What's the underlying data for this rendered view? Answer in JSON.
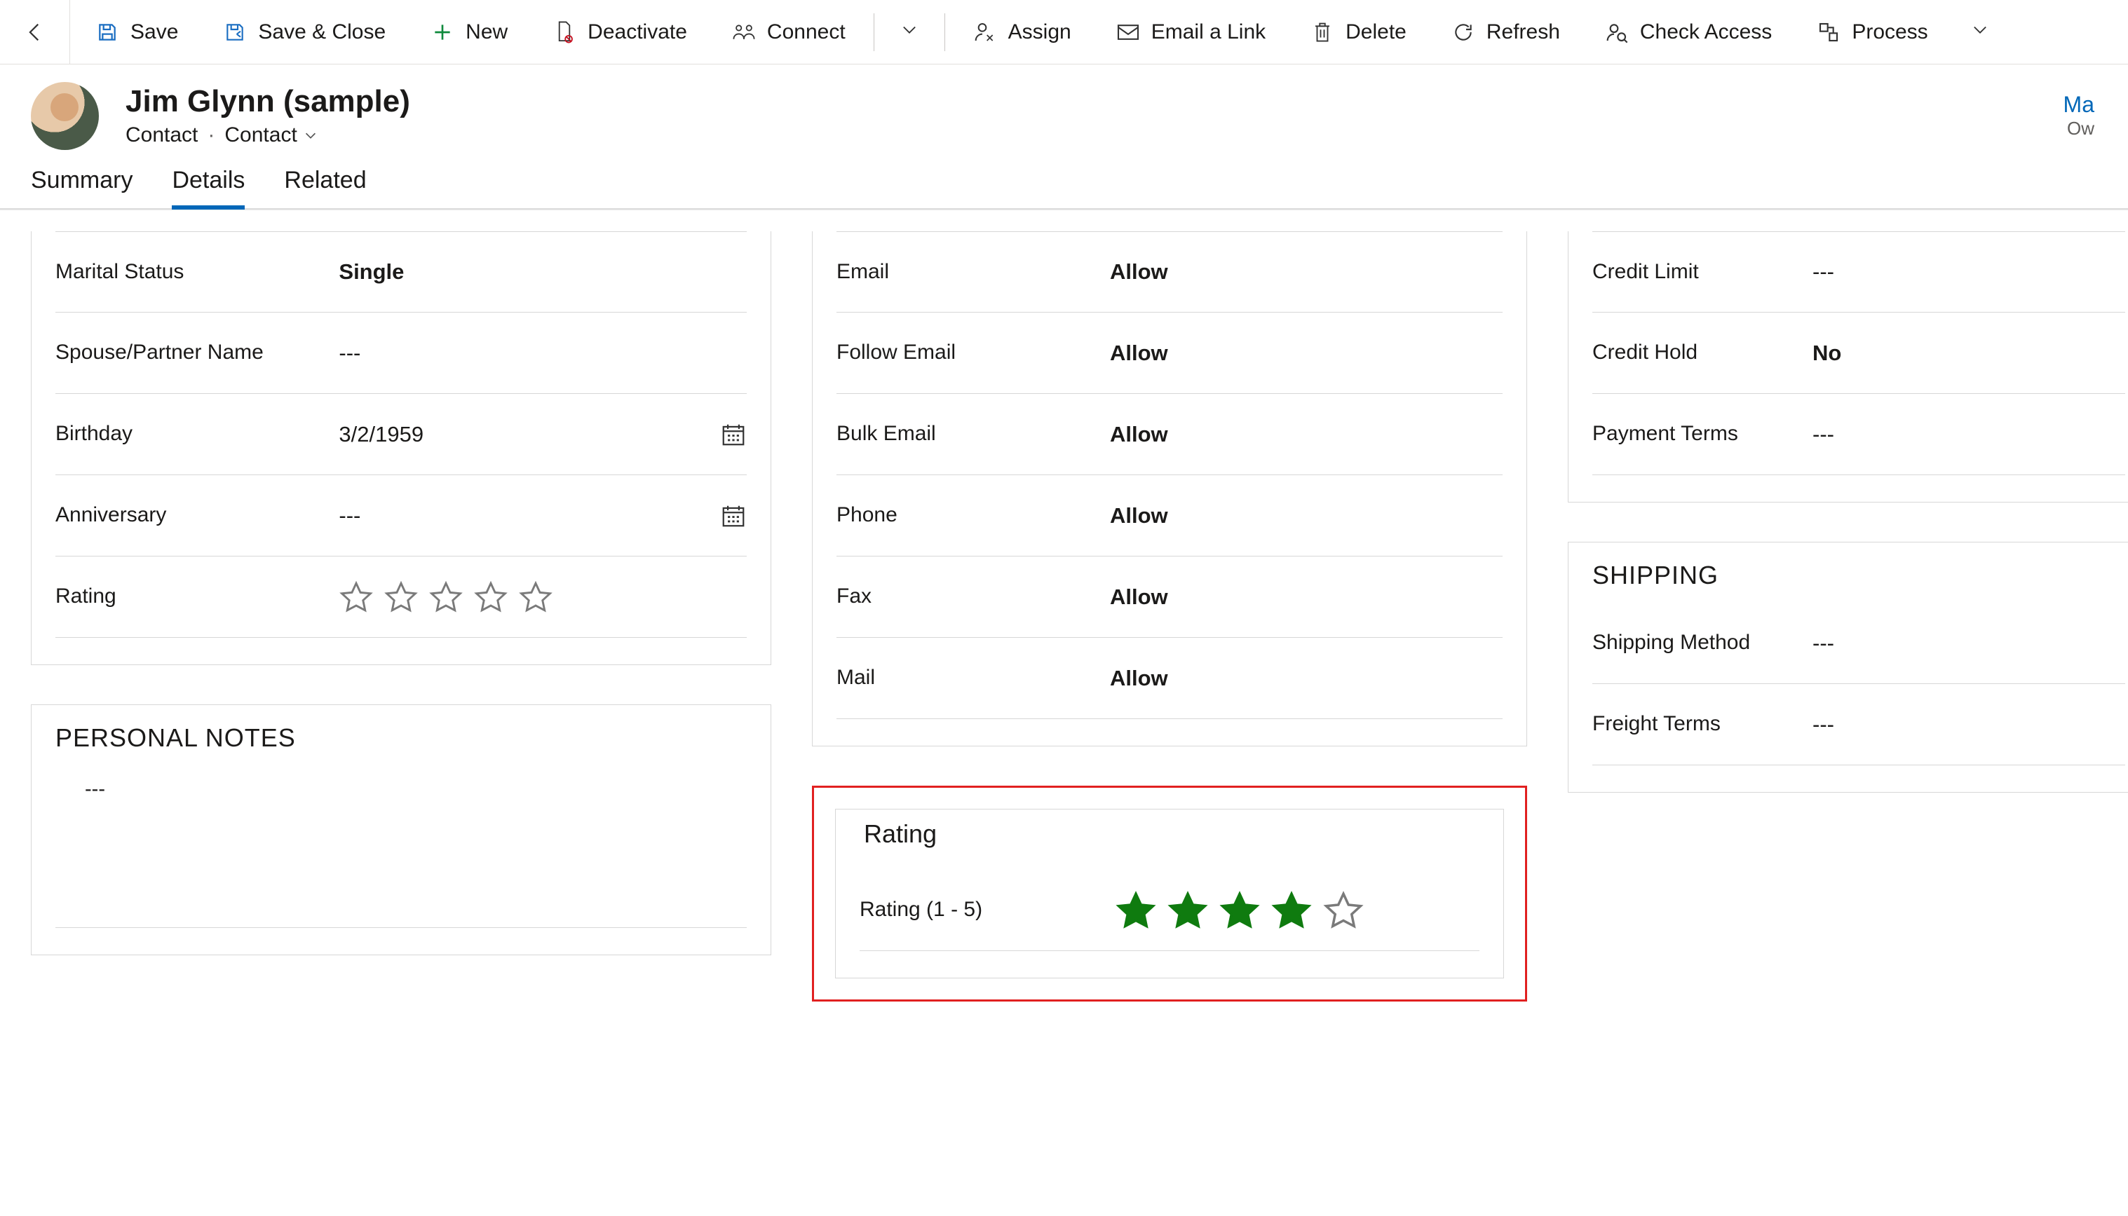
{
  "cmdbar": {
    "save": "Save",
    "save_close": "Save & Close",
    "new": "New",
    "deactivate": "Deactivate",
    "connect": "Connect",
    "assign": "Assign",
    "email_link": "Email a Link",
    "delete": "Delete",
    "refresh": "Refresh",
    "check_access": "Check Access",
    "process": "Process"
  },
  "record": {
    "title": "Jim Glynn (sample)",
    "entity": "Contact",
    "form": "Contact",
    "owner_link": "Ma",
    "owner_label": "Ow"
  },
  "tabs": {
    "summary": "Summary",
    "details": "Details",
    "related": "Related"
  },
  "personal": {
    "marital_status_label": "Marital Status",
    "marital_status_value": "Single",
    "spouse_label": "Spouse/Partner Name",
    "spouse_value": "---",
    "birthday_label": "Birthday",
    "birthday_value": "3/2/1959",
    "anniversary_label": "Anniversary",
    "anniversary_value": "---",
    "rating_label": "Rating",
    "rating_value": 0
  },
  "notes": {
    "section_title": "PERSONAL NOTES",
    "value": "---"
  },
  "contact_pref": {
    "email_label": "Email",
    "email_value": "Allow",
    "follow_email_label": "Follow Email",
    "follow_email_value": "Allow",
    "bulk_email_label": "Bulk Email",
    "bulk_email_value": "Allow",
    "phone_label": "Phone",
    "phone_value": "Allow",
    "fax_label": "Fax",
    "fax_value": "Allow",
    "mail_label": "Mail",
    "mail_value": "Allow"
  },
  "rating_card": {
    "section_title": "Rating",
    "field_label": "Rating (1 - 5)",
    "value": 4
  },
  "billing": {
    "credit_limit_label": "Credit Limit",
    "credit_limit_value": "---",
    "credit_hold_label": "Credit Hold",
    "credit_hold_value": "No",
    "payment_terms_label": "Payment Terms",
    "payment_terms_value": "---"
  },
  "shipping": {
    "section_title": "SHIPPING",
    "method_label": "Shipping Method",
    "method_value": "---",
    "freight_label": "Freight Terms",
    "freight_value": "---"
  }
}
